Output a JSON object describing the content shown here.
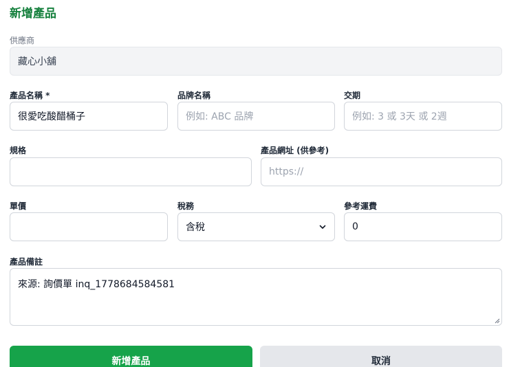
{
  "form": {
    "title": "新增產品",
    "supplier": {
      "label": "供應商",
      "value": "藏心小舖"
    },
    "product_name": {
      "label": "產品名稱 *",
      "value": "很愛吃酸醋桶子"
    },
    "brand_name": {
      "label": "品牌名稱",
      "placeholder": "例如: ABC 品牌"
    },
    "lead_time": {
      "label": "交期",
      "placeholder": "例如: 3 或 3天 或 2週"
    },
    "spec": {
      "label": "規格",
      "value": ""
    },
    "product_url": {
      "label": "產品網址 (供參考)",
      "placeholder": "https://"
    },
    "unit_price": {
      "label": "單價",
      "value": ""
    },
    "tax": {
      "label": "稅務",
      "selected": "含稅"
    },
    "shipping_ref": {
      "label": "參考運費",
      "value": "0"
    },
    "notes": {
      "label": "產品備註",
      "value": "來源: 詢價單 inq_1778684584581"
    },
    "submit_label": "新增產品",
    "cancel_label": "取消"
  },
  "colors": {
    "accent": "#16a34a",
    "title": "#15803d",
    "secondary_button": "#e5e7eb"
  }
}
